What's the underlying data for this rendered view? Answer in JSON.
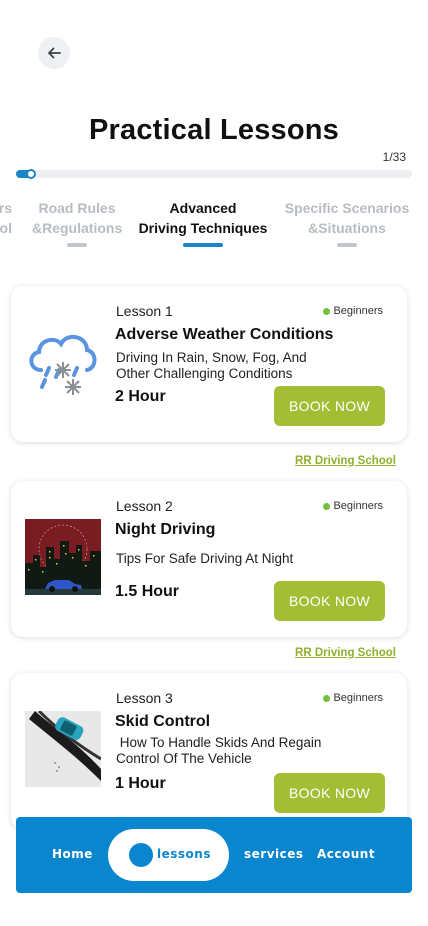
{
  "header": {
    "title": "Practical Lessons",
    "counter": "1/33",
    "progress": 0.04
  },
  "tabs": [
    {
      "line1": "rs",
      "line2": "rol",
      "active": false
    },
    {
      "line1": "Road Rules",
      "line2": "&Regulations",
      "active": false
    },
    {
      "line1": "Advanced",
      "line2": "Driving Techniques",
      "active": true
    },
    {
      "line1": "Specific Scenarios",
      "line2": "&Situations",
      "active": false
    }
  ],
  "lessons": [
    {
      "number": "Lesson 1",
      "level": "Beginners",
      "name": "Adverse Weather Conditions",
      "description": "Driving In Rain, Snow, Fog, And Other Challenging Conditions",
      "duration": "2 Hour",
      "button": "BOOK NOW",
      "school": "RR Driving School",
      "icon": "weather-storm-icon"
    },
    {
      "number": "Lesson 2",
      "level": "Beginners",
      "name": "Night Driving",
      "description": "Tips For Safe Driving At Night",
      "duration": "1.5 Hour",
      "button": "BOOK NOW",
      "school": "RR Driving School",
      "icon": "night-city-car-image"
    },
    {
      "number": "Lesson 3",
      "level": "Beginners",
      "name": "Skid Control",
      "description": " How To Handle Skids And Regain Control Of The Vehicle",
      "duration": "1 Hour",
      "button": "BOOK NOW",
      "icon": "skidding-car-image"
    }
  ],
  "bottom_nav": {
    "home": "Home",
    "lessons": "lessons",
    "services": "services",
    "account": "Account"
  },
  "colors": {
    "accent": "#1c85c8",
    "nav_bg": "#0a86cf",
    "button": "#a3bd35",
    "link": "#8fb031",
    "badge_dot": "#6fc23a"
  }
}
